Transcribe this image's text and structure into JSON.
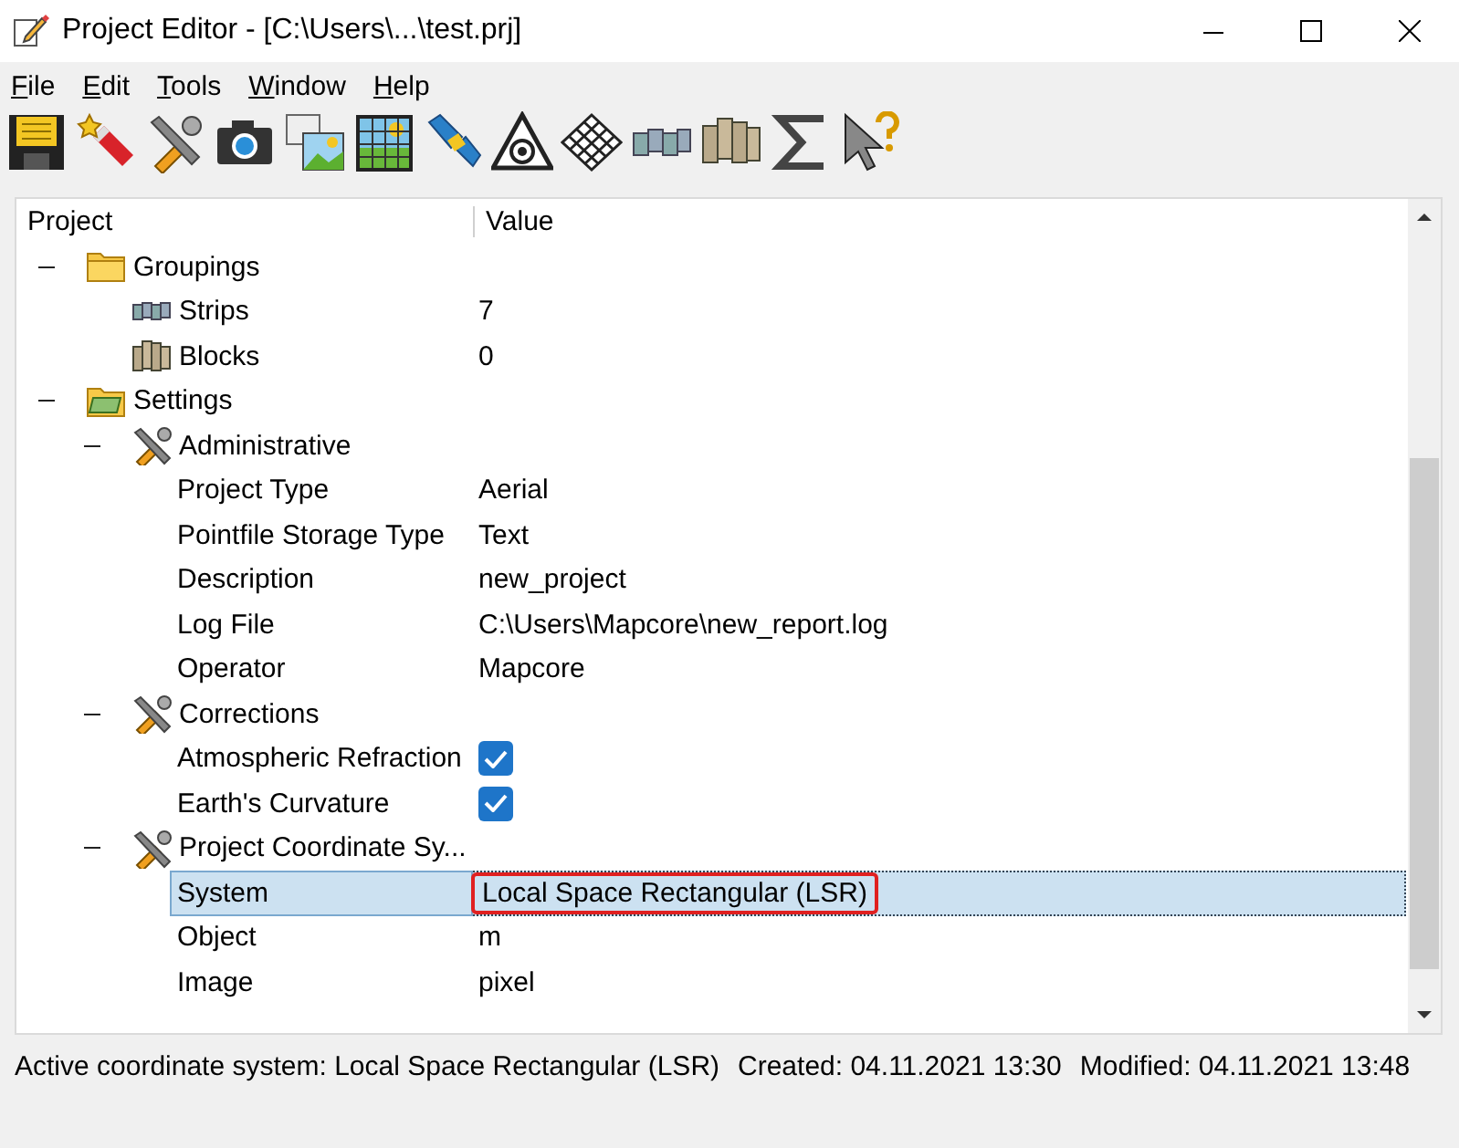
{
  "window": {
    "title": "Project Editor - [C:\\Users\\...\\test.prj]"
  },
  "menu": [
    {
      "label": "File"
    },
    {
      "label": "Edit"
    },
    {
      "label": "Tools"
    },
    {
      "label": "Window"
    },
    {
      "label": "Help"
    }
  ],
  "tree": {
    "columns": [
      "Project",
      "Value"
    ],
    "items": [
      {
        "kind": "folder",
        "label": "Groupings",
        "expanded": true,
        "selected": false,
        "children": [
          {
            "kind": "strips",
            "label": "Strips",
            "value": "7",
            "selected": false
          },
          {
            "kind": "blocks",
            "label": "Blocks",
            "value": "0",
            "selected": false
          }
        ]
      },
      {
        "kind": "settings",
        "label": "Settings",
        "expanded": true,
        "selected": false,
        "children": [
          {
            "kind": "tools",
            "label": "Administrative",
            "expanded": true,
            "selected": false,
            "children": [
              {
                "kind": "text",
                "label": "Project Type",
                "value": "Aerial",
                "selected": false
              },
              {
                "kind": "text",
                "label": "Pointfile Storage Type",
                "value": "Text",
                "selected": false
              },
              {
                "kind": "text",
                "label": "Description",
                "value": "new_project",
                "selected": false
              },
              {
                "kind": "text",
                "label": "Log File",
                "value": "C:\\Users\\Mapcore\\new_report.log",
                "selected": false
              },
              {
                "kind": "text",
                "label": "Operator",
                "value": "Mapcore",
                "selected": false
              }
            ]
          },
          {
            "kind": "tools",
            "label": "Corrections",
            "expanded": true,
            "selected": false,
            "children": [
              {
                "kind": "check",
                "label": "Atmospheric Refraction",
                "checked": true,
                "selected": false
              },
              {
                "kind": "check",
                "label": "Earth's Curvature",
                "checked": true,
                "selected": false
              }
            ]
          },
          {
            "kind": "tools",
            "label": "Project Coordinate Sy...",
            "expanded": true,
            "selected": false,
            "children": [
              {
                "kind": "text",
                "label": "System",
                "value": "Local Space Rectangular (LSR)",
                "selected": true,
                "annotated": true
              },
              {
                "kind": "text",
                "label": "Object",
                "value": "m",
                "selected": false
              },
              {
                "kind": "text",
                "label": "Image",
                "value": "pixel",
                "selected": false
              }
            ]
          }
        ]
      }
    ]
  },
  "status_bar": [
    "Active coordinate system: Local Space Rectangular (LSR)",
    "Created: 04.11.2021 13:30",
    "Modified: 04.11.2021 13:48"
  ]
}
